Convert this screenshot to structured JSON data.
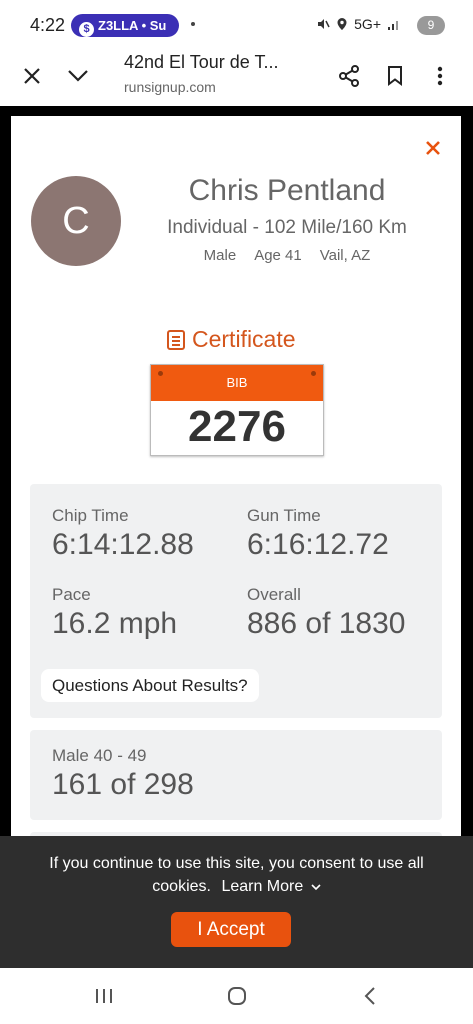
{
  "status": {
    "time": "4:22",
    "pill": "Z3LLA • Su",
    "network": "5G+",
    "badge": "9"
  },
  "browser": {
    "title": "42nd El Tour de T...",
    "url": "runsignup.com"
  },
  "profile": {
    "initial": "C",
    "name": "Chris Pentland",
    "division": "Individual - 102 Mile/160 Km",
    "gender": "Male",
    "age": "Age 41",
    "location": "Vail, AZ"
  },
  "certificate": {
    "label": "Certificate"
  },
  "bib": {
    "label": "BIB",
    "number": "2276"
  },
  "stats": {
    "chip_label": "Chip Time",
    "chip_value": "6:14:12.88",
    "gun_label": "Gun Time",
    "gun_value": "6:16:12.72",
    "pace_label": "Pace",
    "pace_value": "16.2 mph",
    "overall_label": "Overall",
    "overall_value": "886 of 1830",
    "questions_label": "Questions About Results?"
  },
  "group": {
    "label": "Male 40 - 49",
    "value": "161 of 298"
  },
  "cookie": {
    "text": "If you continue to use this site, you consent to use all cookies.",
    "learn_more": "Learn More",
    "accept": "I Accept"
  },
  "colors": {
    "accent": "#e8520e",
    "pill": "#3b2fb5",
    "avatar": "#8c7672"
  }
}
